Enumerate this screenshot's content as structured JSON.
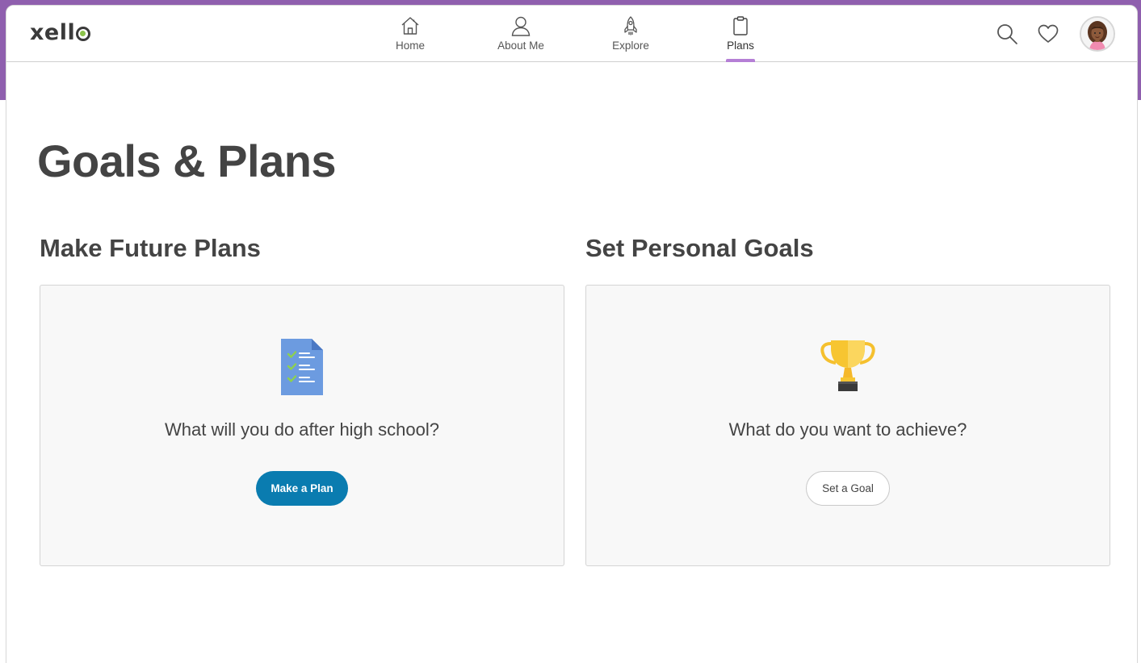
{
  "brand": {
    "logo_text": "xell"
  },
  "nav": {
    "items": [
      {
        "label": "Home",
        "icon": "house-icon"
      },
      {
        "label": "About Me",
        "icon": "person-icon"
      },
      {
        "label": "Explore",
        "icon": "rocket-icon"
      },
      {
        "label": "Plans",
        "icon": "clipboard-icon",
        "active": true
      }
    ]
  },
  "header_actions": {
    "search_icon": "search-icon",
    "favorites_icon": "heart-icon",
    "avatar_icon": "avatar"
  },
  "page": {
    "title": "Goals & Plans",
    "sections": [
      {
        "title": "Make Future Plans",
        "icon": "checklist-document-icon",
        "prompt": "What will you do after high school?",
        "button_label": "Make a Plan"
      },
      {
        "title": "Set Personal Goals",
        "icon": "trophy-icon",
        "prompt": "What do you want to achieve?",
        "button_label": "Set a Goal"
      }
    ]
  },
  "colors": {
    "accent_purple": "#8f5fae",
    "nav_active_underline": "#b57fd6",
    "primary_button": "#0a7cb0",
    "logo_dot": "#8bc34a"
  }
}
